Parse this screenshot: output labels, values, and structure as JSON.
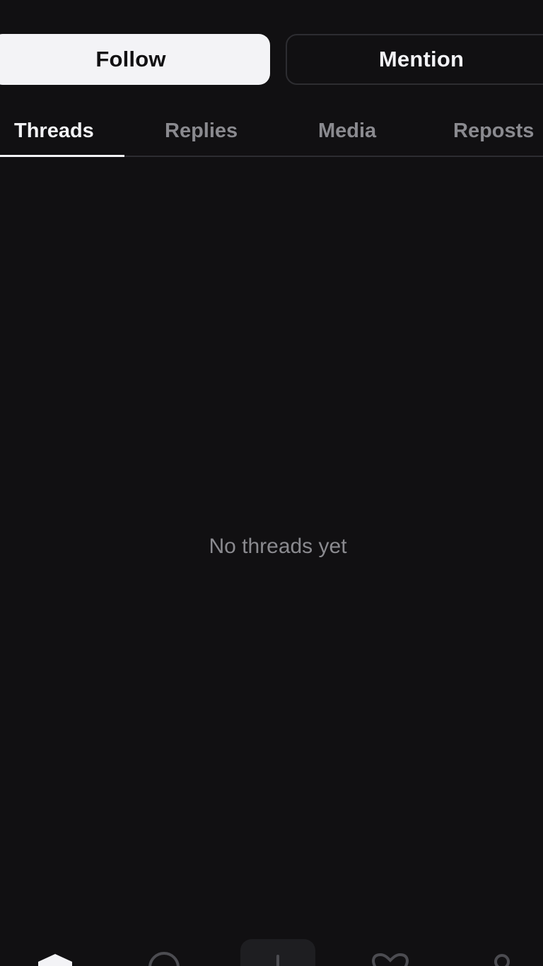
{
  "profile_actions": {
    "follow_label": "Follow",
    "mention_label": "Mention"
  },
  "tabs": [
    {
      "label": "Threads",
      "active": true
    },
    {
      "label": "Replies",
      "active": false
    },
    {
      "label": "Media",
      "active": false
    },
    {
      "label": "Reposts",
      "active": false
    }
  ],
  "empty_state": {
    "message": "No threads yet"
  },
  "bottom_nav": {
    "items": [
      {
        "icon": "home-icon",
        "active": true
      },
      {
        "icon": "search-icon",
        "active": false
      },
      {
        "icon": "compose-icon",
        "active": false
      },
      {
        "icon": "heart-icon",
        "active": false
      },
      {
        "icon": "profile-icon",
        "active": false
      }
    ]
  },
  "colors": {
    "background": "#111012",
    "primary_text": "#f3f3f6",
    "secondary_text": "#8a8a8f",
    "divider": "#2d2d31"
  }
}
